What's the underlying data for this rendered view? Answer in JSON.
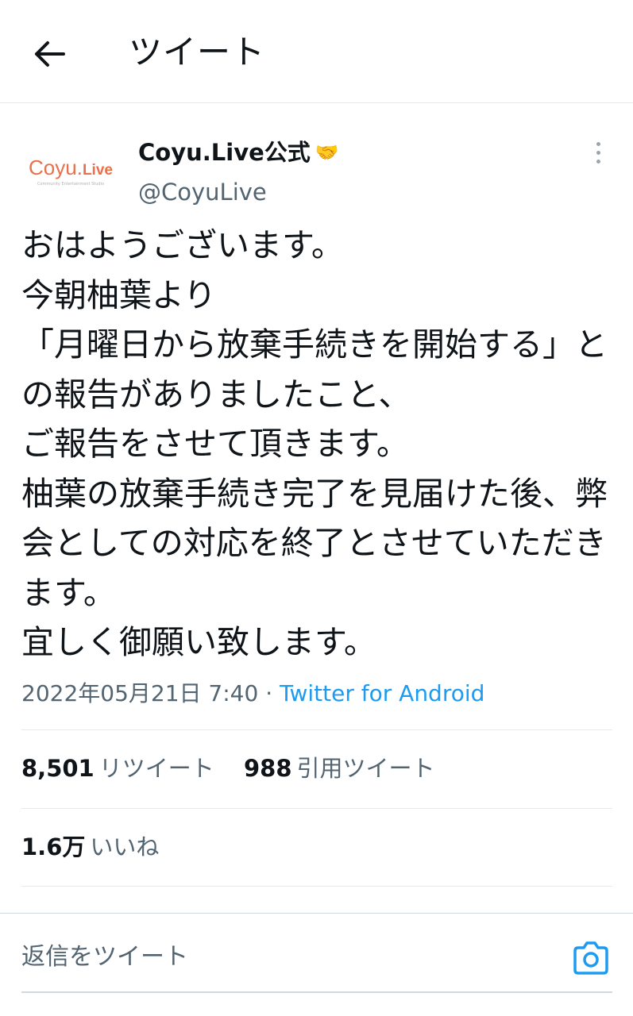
{
  "header": {
    "title": "ツイート",
    "back_icon": "arrow-left-icon"
  },
  "tweet": {
    "avatar": {
      "logo_main": "Coyu.",
      "logo_accent": "Live",
      "logo_sub": "Community Entertainment Studio"
    },
    "author": {
      "name": "Coyu.Live公式",
      "badge_emoji": "🤝",
      "handle": "@CoyuLive"
    },
    "text": "おはようございます。\n今朝柚葉より\n「月曜日から放棄手続きを開始する」との報告がありましたこと、\nご報告をさせて頂きます。\n柚葉の放棄手続き完了を見届けた後、弊会としての対応を終了とさせていただきます。\n宜しく御願い致します。",
    "timestamp": "2022年05月21日 7:40",
    "separator": "·",
    "source": "Twitter for Android",
    "stats": {
      "retweets_count": "8,501",
      "retweets_label": "リツイート",
      "quotes_count": "988",
      "quotes_label": "引用ツイート",
      "likes_count": "1.6万",
      "likes_label": "いいね"
    }
  },
  "reply": {
    "placeholder": "返信をツイート",
    "camera_icon": "camera-icon"
  },
  "colors": {
    "accent": "#1d9bf0",
    "secondary_text": "#536471",
    "logo": "#e9704a"
  }
}
